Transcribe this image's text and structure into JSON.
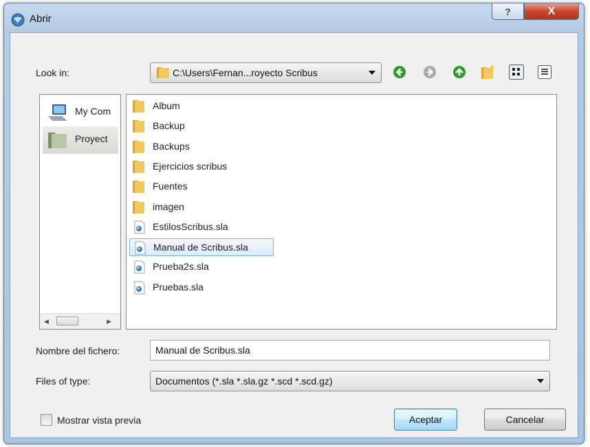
{
  "window": {
    "title": "Abrir",
    "help_label": "?",
    "close_label": "X"
  },
  "lookin": {
    "label": "Look in:",
    "path": "C:\\Users\\Fernan...royecto Scribus"
  },
  "toolbar": {
    "icons": [
      "back-icon",
      "forward-icon",
      "up-icon",
      "new-folder-icon",
      "list-view-icon",
      "detail-view-icon"
    ]
  },
  "sidebar": {
    "items": [
      {
        "label": "My Com",
        "icon": "computer-icon"
      },
      {
        "label": "Proyect",
        "icon": "folder-icon",
        "selected": true
      }
    ]
  },
  "files": [
    {
      "name": "Album",
      "type": "folder"
    },
    {
      "name": "Backup",
      "type": "folder"
    },
    {
      "name": "Backups",
      "type": "folder"
    },
    {
      "name": "Ejercicios scribus",
      "type": "folder"
    },
    {
      "name": "Fuentes",
      "type": "folder"
    },
    {
      "name": "imagen",
      "type": "folder"
    },
    {
      "name": "EstilosScribus.sla",
      "type": "document"
    },
    {
      "name": "Manual de Scribus.sla",
      "type": "document",
      "selected": true
    },
    {
      "name": "Prueba2s.sla",
      "type": "document"
    },
    {
      "name": "Pruebas.sla",
      "type": "document"
    }
  ],
  "filename": {
    "label": "Nombre del fichero:",
    "value": "Manual de Scribus.sla"
  },
  "filetype": {
    "label": "Files of type:",
    "value": "Documentos (*.sla *.sla.gz *.scd *.scd.gz)"
  },
  "preview": {
    "label": "Mostrar vista previa",
    "checked": false
  },
  "buttons": {
    "accept": "Aceptar",
    "cancel": "Cancelar"
  },
  "colors": {
    "folder": "#e8b94a",
    "selection_border": "#84acdd",
    "default_button_border": "#3c7fb1",
    "close_button": "#c9462f",
    "nav_green": "#2f9a2a"
  }
}
